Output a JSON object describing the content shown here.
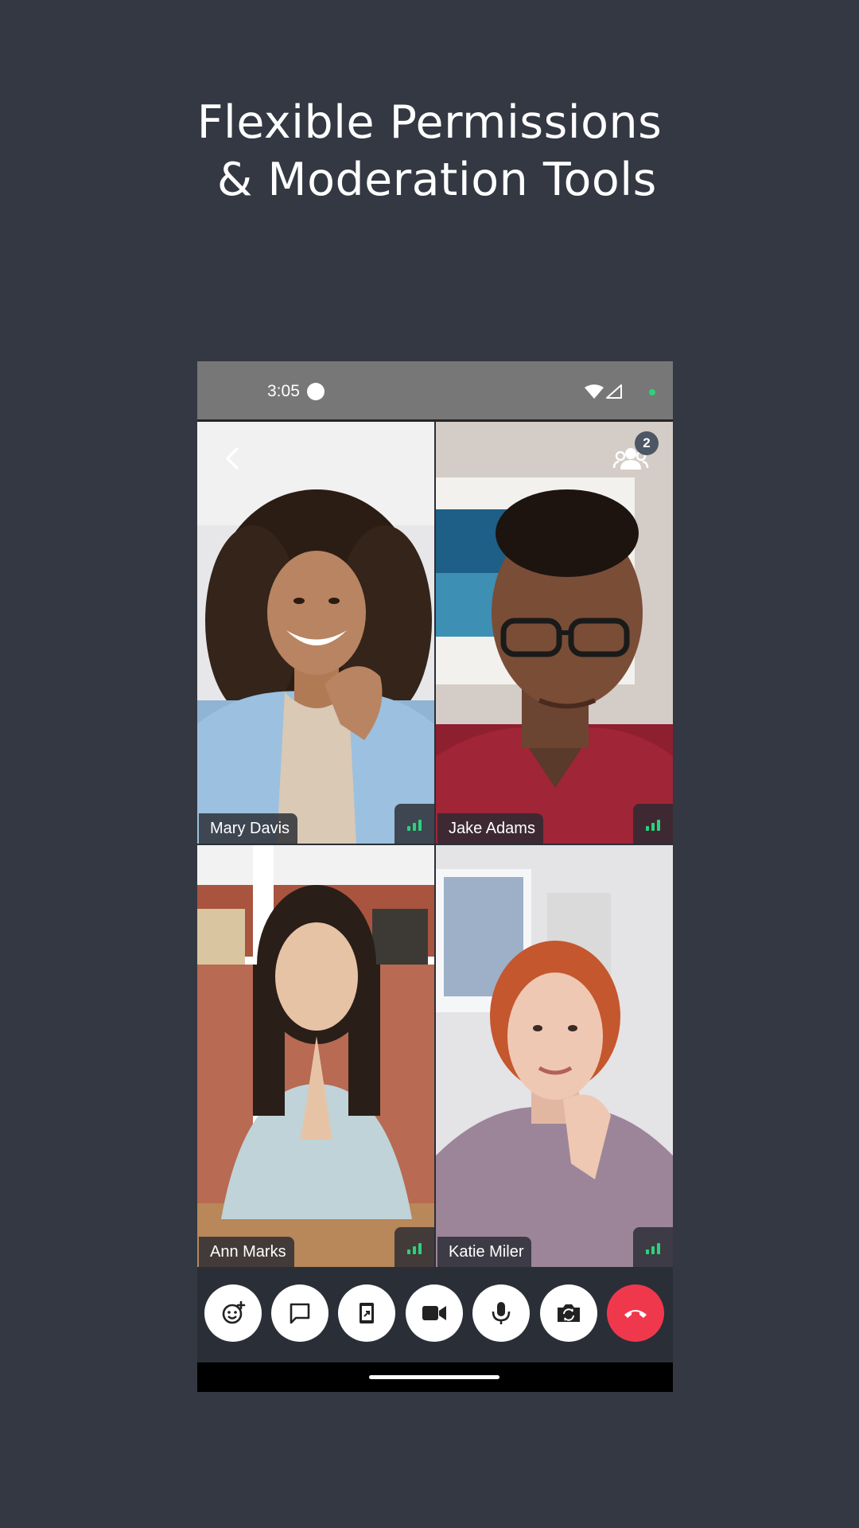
{
  "headline": {
    "line1": "Flexible Permissions",
    "line2": " & Moderation Tools"
  },
  "status_bar": {
    "time": "3:05"
  },
  "header": {
    "back_icon": "chevron-left-icon",
    "participants_icon": "participants-icon",
    "participants_count": "2"
  },
  "participants": [
    {
      "name": "Mary Davis",
      "signal_bars": 3
    },
    {
      "name": "Jake Adams",
      "signal_bars": 3
    },
    {
      "name": "Ann Marks",
      "signal_bars": 3
    },
    {
      "name": "Katie Miler",
      "signal_bars": 3
    }
  ],
  "controls": [
    {
      "icon": "add-reaction-icon"
    },
    {
      "icon": "chat-icon"
    },
    {
      "icon": "screen-share-icon"
    },
    {
      "icon": "video-camera-icon"
    },
    {
      "icon": "microphone-icon"
    },
    {
      "icon": "flip-camera-icon"
    },
    {
      "icon": "end-call-icon"
    }
  ],
  "colors": {
    "background": "#333842",
    "accent_green": "#2bd27a",
    "end_call_red": "#f0384d",
    "status_bar": "#777777"
  }
}
